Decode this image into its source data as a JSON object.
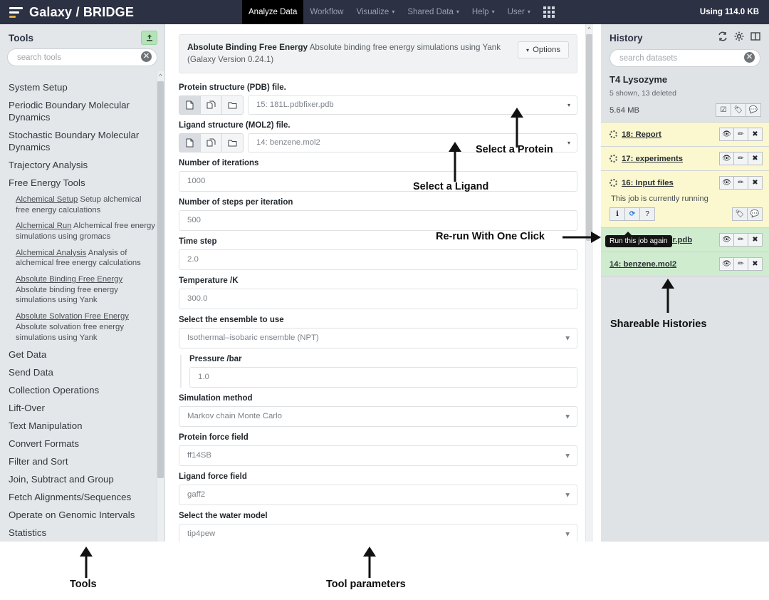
{
  "masthead": {
    "brand": "Galaxy / BRIDGE",
    "logo_icon": "galaxy-hamburger-logo",
    "nav": [
      {
        "label": "Analyze Data",
        "active": true,
        "caret": false
      },
      {
        "label": "Workflow",
        "active": false,
        "caret": false
      },
      {
        "label": "Visualize",
        "active": false,
        "caret": true
      },
      {
        "label": "Shared Data",
        "active": false,
        "caret": true
      },
      {
        "label": "Help",
        "active": false,
        "caret": true
      },
      {
        "label": "User",
        "active": false,
        "caret": true
      }
    ],
    "grid_icon": "apps-grid-icon",
    "quota": "Using 114.0 KB"
  },
  "tools": {
    "title": "Tools",
    "upload_icon": "upload-icon",
    "search_placeholder": "search tools",
    "clear_icon": "clear-circle-icon",
    "sections": [
      {
        "label": "System Setup"
      },
      {
        "label": "Periodic Boundary Molecular Dynamics"
      },
      {
        "label": "Stochastic Boundary Molecular Dynamics"
      },
      {
        "label": "Trajectory Analysis"
      },
      {
        "label": "Free Energy Tools"
      }
    ],
    "free_energy_tools": [
      {
        "name": "Alchemical Setup",
        "desc": "Setup alchemical free energy calculations"
      },
      {
        "name": "Alchemical Run",
        "desc": "Alchemical free energy simulations using gromacs"
      },
      {
        "name": "Alchemical Analysis",
        "desc": "Analysis of alchemical free energy calculations"
      },
      {
        "name": "Absolute Binding Free Energy",
        "desc": "Absolute binding free energy simulations using Yank"
      },
      {
        "name": "Absolute Solvation Free Energy",
        "desc": "Absolute solvation free energy simulations using Yank"
      }
    ],
    "more_sections": [
      {
        "label": "Get Data"
      },
      {
        "label": "Send Data"
      },
      {
        "label": "Collection Operations"
      },
      {
        "label": "Lift-Over"
      },
      {
        "label": "Text Manipulation"
      },
      {
        "label": "Convert Formats"
      },
      {
        "label": "Filter and Sort"
      },
      {
        "label": "Join, Subtract and Group"
      },
      {
        "label": "Fetch Alignments/Sequences"
      },
      {
        "label": "Operate on Genomic Intervals"
      },
      {
        "label": "Statistics"
      }
    ]
  },
  "tool_form": {
    "title": "Absolute Binding Free Energy",
    "description": "Absolute binding free energy simulations using Yank (Galaxy Version 0.24.1)",
    "options_label": "Options",
    "dataset_buttons": [
      {
        "icon": "single-dataset-icon",
        "selected": true
      },
      {
        "icon": "multiple-datasets-icon",
        "selected": false
      },
      {
        "icon": "dataset-collection-icon",
        "selected": false
      }
    ],
    "fields": [
      {
        "label": "Protein structure (PDB) file.",
        "type": "dataset",
        "value": "15: 181L.pdbfixer.pdb"
      },
      {
        "label": "Ligand structure (MOL2) file.",
        "type": "dataset",
        "value": "14: benzene.mol2"
      },
      {
        "label": "Number of iterations",
        "type": "text",
        "value": "1000"
      },
      {
        "label": "Number of steps per iteration",
        "type": "text",
        "value": "500"
      },
      {
        "label": "Time step",
        "type": "text",
        "value": "2.0"
      },
      {
        "label": "Temperature /K",
        "type": "text",
        "value": "300.0"
      },
      {
        "label": "Select the ensemble to use",
        "type": "select",
        "value": "Isothermal–isobaric ensemble (NPT)"
      },
      {
        "label": "Pressure /bar",
        "type": "text",
        "value": "1.0",
        "nested": true
      },
      {
        "label": "Simulation method",
        "type": "select",
        "value": "Markov chain Monte Carlo"
      },
      {
        "label": "Protein force field",
        "type": "select",
        "value": "ff14SB"
      },
      {
        "label": "Ligand force field",
        "type": "select",
        "value": "gaff2"
      },
      {
        "label": "Select the water model",
        "type": "select",
        "value": "tip4pew"
      }
    ]
  },
  "history": {
    "title": "History",
    "header_icons": [
      {
        "name": "refresh-icon"
      },
      {
        "name": "gear-icon"
      },
      {
        "name": "columns-icon"
      }
    ],
    "search_placeholder": "search datasets",
    "clear_icon": "clear-circle-icon",
    "name": "T4 Lysozyme",
    "counts": "5 shown, 13 deleted",
    "size": "5.64 MB",
    "summary_buttons": [
      {
        "name": "select-items-icon",
        "glyph": "☑"
      },
      {
        "name": "tag-icon",
        "glyph": "🏷"
      },
      {
        "name": "annotation-icon",
        "glyph": "💬"
      }
    ],
    "item_actions": [
      {
        "name": "display-eye-icon",
        "glyph": "👁"
      },
      {
        "name": "edit-pencil-icon",
        "glyph": "✏"
      },
      {
        "name": "delete-x-icon",
        "glyph": "✖"
      }
    ],
    "items": [
      {
        "title": "18: Report",
        "state": "running",
        "spinner": true,
        "expanded": false
      },
      {
        "title": "17: experiments",
        "state": "running",
        "spinner": true,
        "expanded": false
      },
      {
        "title": "16: Input files",
        "state": "running",
        "spinner": true,
        "expanded": true,
        "job_message": "This job is currently running",
        "job_buttons": [
          {
            "name": "info-icon",
            "glyph": "ℹ"
          },
          {
            "name": "rerun-icon",
            "glyph": "⟳"
          },
          {
            "name": "help-question-icon",
            "glyph": "?"
          }
        ],
        "extra_buttons": [
          {
            "name": "tag-icon",
            "glyph": "🏷"
          },
          {
            "name": "annotation-icon",
            "glyph": "💬"
          }
        ],
        "tooltip": "Run this job again"
      },
      {
        "title": "15: 181L.pdbfixer.pdb",
        "state": "ok",
        "spinner": false,
        "expanded": false
      },
      {
        "title": "14: benzene.mol2",
        "state": "ok",
        "spinner": false,
        "expanded": false
      }
    ]
  },
  "annotations": [
    {
      "text": "Select a Protein",
      "arrow": "up"
    },
    {
      "text": "Select a Ligand",
      "arrow": "up"
    },
    {
      "text": "Re-run With One Click",
      "arrow": "right"
    },
    {
      "text": "Shareable Histories",
      "arrow": "up"
    },
    {
      "text": "Tools",
      "arrow": "up"
    },
    {
      "text": "Tool parameters",
      "arrow": "up"
    }
  ],
  "colors": {
    "masthead_bg": "#2c3143",
    "panel_bg": "#e3e7ea",
    "history_bg": "#dfe3e6",
    "state_running": "#fbf8cf",
    "state_ok": "#cfeccf",
    "upload_green": "#b5e3b8"
  }
}
